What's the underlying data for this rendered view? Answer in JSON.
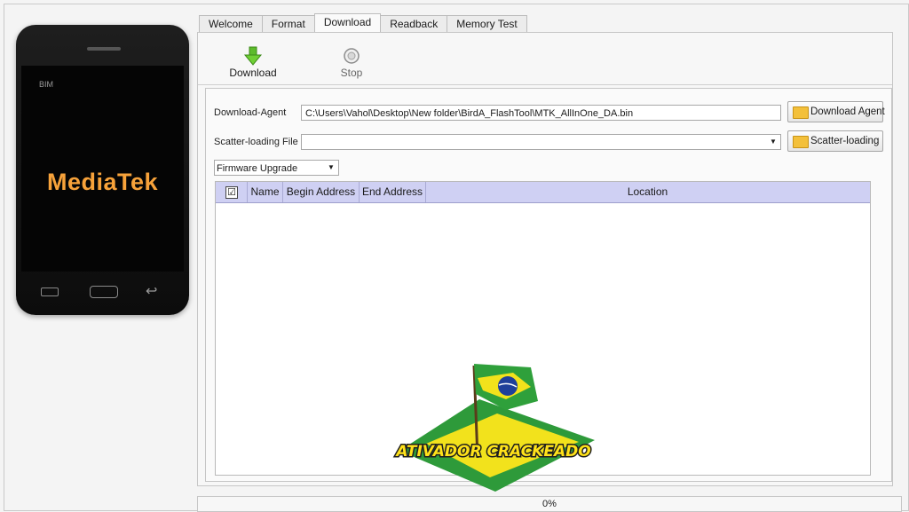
{
  "phone": {
    "carrier_text": "BIM",
    "brand_text": "MediaTek",
    "brand_color": "#f7a23a"
  },
  "tabs": [
    {
      "label": "Welcome",
      "active": false
    },
    {
      "label": "Format",
      "active": false
    },
    {
      "label": "Download",
      "active": true
    },
    {
      "label": "Readback",
      "active": false
    },
    {
      "label": "Memory Test",
      "active": false
    }
  ],
  "toolbar": {
    "download_label": "Download",
    "download_icon": "green-down-arrow-icon",
    "stop_label": "Stop",
    "stop_icon": "stop-circle-icon"
  },
  "form": {
    "download_agent_label": "Download-Agent",
    "download_agent_value": "C:\\Users\\Vahol\\Desktop\\New folder\\BirdA_FlashTool\\MTK_AllInOne_DA.bin",
    "download_agent_button": "Download Agent",
    "scatter_label": "Scatter-loading File",
    "scatter_value": "",
    "scatter_button": "Scatter-loading",
    "mode_value": "Firmware Upgrade"
  },
  "table": {
    "columns": [
      "Name",
      "Begin Address",
      "End Address",
      "Location"
    ],
    "header_checkbox": "☑",
    "rows": []
  },
  "watermark": {
    "text": "ATIVADOR CRACKEADO"
  },
  "status": {
    "progress_percent": 0,
    "progress_text": "0%"
  }
}
